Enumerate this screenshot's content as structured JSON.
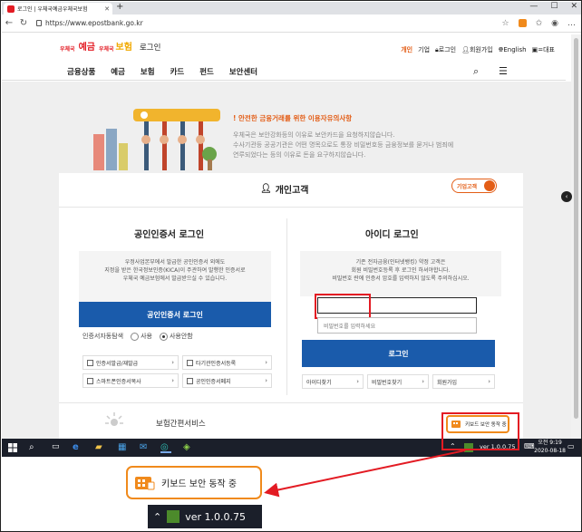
{
  "browser": {
    "tab_title": "로그인 | 우체국예금우체국보험",
    "url": "https://www.epostbank.go.kr",
    "new_tab_icon": "plus-icon"
  },
  "header": {
    "logo_parts": [
      "우체국",
      "예금",
      "우체국",
      "보험"
    ],
    "page_name": "로그인",
    "util_links": [
      "개인",
      "기업",
      "로그인",
      "회원가입",
      "English",
      "=대표"
    ]
  },
  "gnb": {
    "items": [
      "금융상품",
      "예금",
      "보험",
      "카드",
      "펀드",
      "보안센터"
    ]
  },
  "notice": {
    "title": "! 안전한 금융거래를 위한 이용자유의사항",
    "lines": [
      "우체국은 보안강화등의 이유로 보안카드을 요청하지않습니다.",
      "수사기관등 공공기관은 어떤 명목으로도 통장 비밀번호등 금융정보를 묻거나 범죄에",
      "연루되었다는 등의 이유로 돈을 요구하지않습니다."
    ]
  },
  "card": {
    "title": "개인고객",
    "toggle_label": "기업고객",
    "cert": {
      "title": "공인인증서 로그인",
      "info": [
        "우정사업본부에서 발급한 공인인증서 외에도",
        "지정을 받은 한국정보인증(KICA)이 주관하여 발행한 인증서로",
        "우체국 예금보험에서 발급받으실 수 있습니다."
      ],
      "button": "공인인증서 로그인",
      "radio_label": "인증서자동탐색",
      "radio_use": "사용",
      "radio_nouse": "사용안함",
      "links": [
        "인증서발급/재발급",
        "타기관인증서등록",
        "스마트폰인증서복사",
        "공인인증서폐지"
      ]
    },
    "id": {
      "title": "아이디 로그인",
      "info": [
        "기존 전자금융(인터넷뱅킹) 약정 고객은",
        "회원 비밀번호등록 후 로그인 하셔야합니다.",
        "비밀번호 란에 인증서 암호를 입력하지 않도록 주의하십시오."
      ],
      "id_placeholder": "",
      "pw_placeholder": "비밀번호를 입력하세요",
      "button": "로그인",
      "links": [
        "아이디찾기",
        "비밀번호찾기",
        "회원가입"
      ]
    },
    "insurance_title": "보험간편서비스"
  },
  "taskbar": {
    "version": "ver 1.0.0.75",
    "time": "오전 9:19",
    "date": "2020-08-18"
  },
  "keyboard_popup": {
    "label": "키보드 보안 동작 중"
  },
  "zoom": {
    "version": "ver 1.0.0.75"
  },
  "colors": {
    "accent": "#e35d16",
    "brand_red": "#e31b23",
    "login_blue": "#1a5bab",
    "highlight_red": "#e31b23",
    "popup_orange": "#f08a1c"
  }
}
